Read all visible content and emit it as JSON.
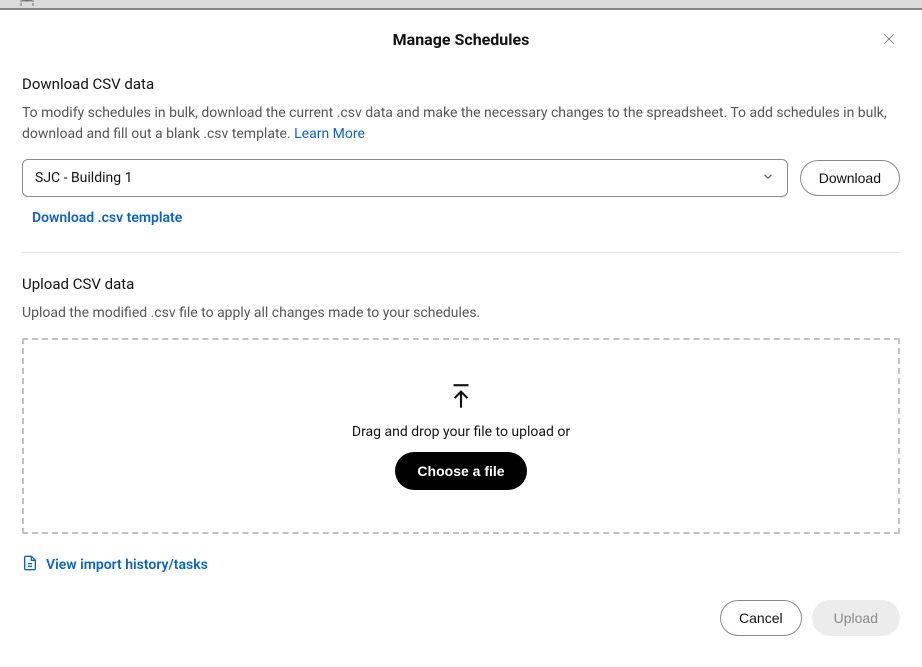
{
  "modal": {
    "title": "Manage Schedules"
  },
  "download": {
    "heading": "Download CSV data",
    "description_part1": "To modify schedules in bulk, download the current .csv data and make the necessary changes to the spreadsheet. To add schedules in bulk, download and fill out a blank .csv template. ",
    "learn_more": "Learn More",
    "selected_location": "SJC - Building 1",
    "download_label": "Download",
    "template_link": "Download .csv template"
  },
  "upload": {
    "heading": "Upload CSV data",
    "description": "Upload the modified .csv file to apply all changes made to your schedules.",
    "drop_text": "Drag and drop your file to upload or",
    "choose_label": "Choose a file"
  },
  "history": {
    "link_label": "View import history/tasks"
  },
  "footer": {
    "cancel_label": "Cancel",
    "upload_label": "Upload"
  }
}
